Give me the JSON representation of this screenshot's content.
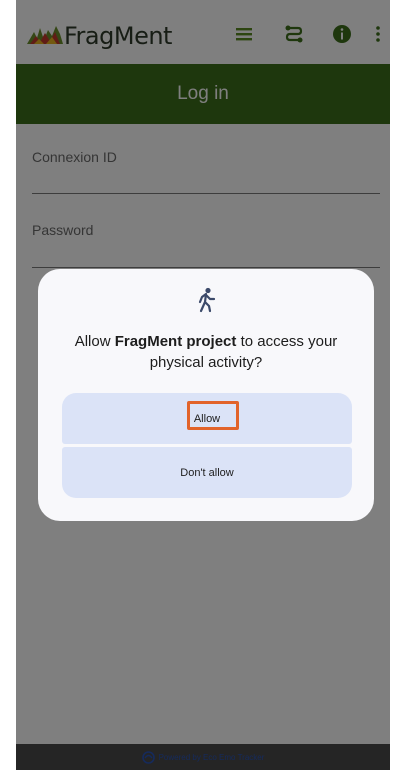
{
  "app": {
    "title": "FragMent"
  },
  "header": {
    "title": "Log in"
  },
  "form": {
    "connexion_label": "Connexion ID",
    "password_label": "Password"
  },
  "dialog": {
    "prefix": "Allow ",
    "app_name": "FragMent project",
    "suffix": " to access your physical activity?",
    "allow_label": "Allow",
    "deny_label": "Don't allow"
  },
  "footer": {
    "text": "Powered by Eco Emo Tracker"
  },
  "icons": [
    "app-logo-icon",
    "menu-icon",
    "route-icon",
    "info-icon",
    "more-vert-icon",
    "walking-person-icon",
    "eco-emo-logo-icon"
  ],
  "colors": {
    "header": "#3c6e1a",
    "highlight": "#e2632a",
    "button_bg": "#dbe3f7"
  }
}
